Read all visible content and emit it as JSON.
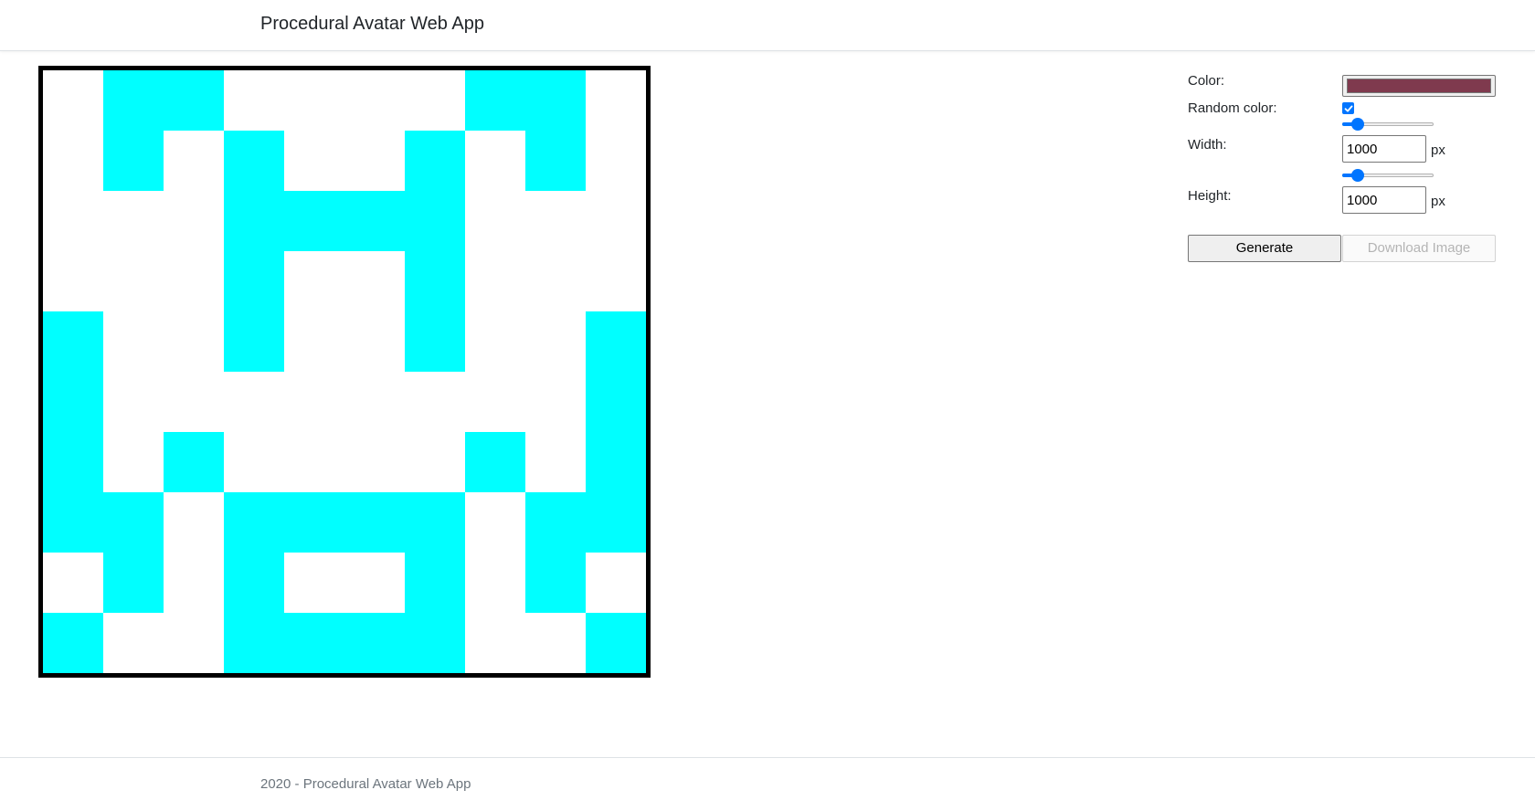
{
  "app": {
    "title": "Procedural Avatar Web App"
  },
  "avatar": {
    "cell_color": "#00FFFF",
    "background_color": "#FFFFFF",
    "grid": [
      [
        0,
        1,
        1,
        0,
        0,
        0,
        0,
        1,
        1,
        0
      ],
      [
        0,
        1,
        0,
        1,
        0,
        0,
        1,
        0,
        1,
        0
      ],
      [
        0,
        0,
        0,
        1,
        1,
        1,
        1,
        0,
        0,
        0
      ],
      [
        0,
        0,
        0,
        1,
        0,
        0,
        1,
        0,
        0,
        0
      ],
      [
        1,
        0,
        0,
        1,
        0,
        0,
        1,
        0,
        0,
        1
      ],
      [
        1,
        0,
        0,
        0,
        0,
        0,
        0,
        0,
        0,
        1
      ],
      [
        1,
        0,
        1,
        0,
        0,
        0,
        0,
        1,
        0,
        1
      ],
      [
        1,
        1,
        0,
        1,
        1,
        1,
        1,
        0,
        1,
        1
      ],
      [
        0,
        1,
        0,
        1,
        0,
        0,
        1,
        0,
        1,
        0
      ],
      [
        1,
        0,
        0,
        1,
        1,
        1,
        1,
        0,
        0,
        1
      ]
    ]
  },
  "controls": {
    "color_label": "Color:",
    "color_value": "#7F3A4E",
    "random_color_label": "Random color:",
    "random_color_checked": true,
    "width_label": "Width:",
    "width_value": "1000",
    "width_slider_fraction": 0.12,
    "height_label": "Height:",
    "height_value": "1000",
    "height_slider_fraction": 0.12,
    "unit": "px",
    "generate_label": "Generate",
    "download_label": "Download Image"
  },
  "footer": {
    "text": "2020 - Procedural Avatar Web App"
  }
}
